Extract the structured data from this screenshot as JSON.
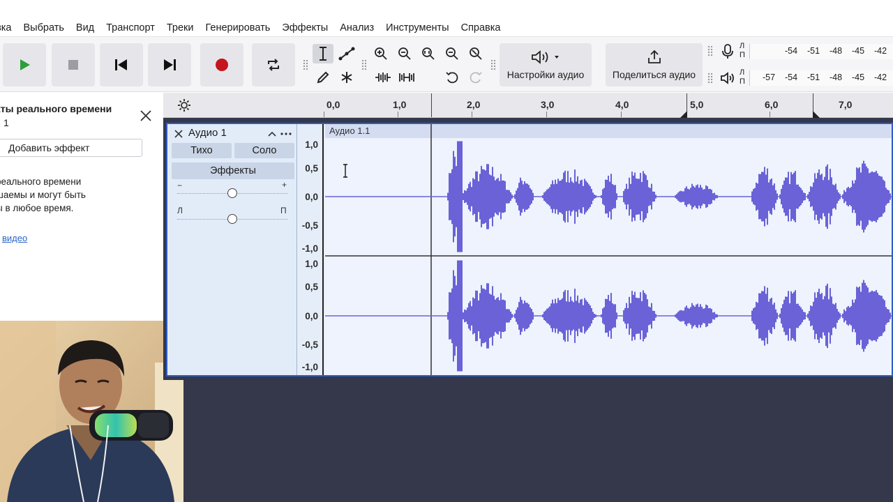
{
  "menu": {
    "items": [
      "авка",
      "Выбрать",
      "Вид",
      "Транспорт",
      "Треки",
      "Генерировать",
      "Эффекты",
      "Анализ",
      "Инструменты",
      "Справка"
    ]
  },
  "toolbar": {
    "audio_settings_label": "Настройки аудио",
    "share_label": "Поделиться аудио"
  },
  "meters": {
    "record": {
      "channel_labels": "Л\nП",
      "scale": [
        "-54",
        "-51",
        "-48",
        "-45",
        "-42"
      ]
    },
    "playback": {
      "channel_labels": "Л\nП",
      "scale": [
        "-57",
        "-54",
        "-51",
        "-48",
        "-45",
        "-42"
      ]
    }
  },
  "effects_panel": {
    "title": "екты реального времени",
    "subtitle": "1",
    "add_effect_label": "Добавить эффект",
    "info_lines": [
      "реального времени",
      "шаемы и могут быть",
      "ы в любое время."
    ],
    "link_text": "видео"
  },
  "timeline": {
    "labels": [
      "0,0",
      "1,0",
      "2,0",
      "3,0",
      "4,0",
      "5,0",
      "6,0",
      "7,0"
    ]
  },
  "track": {
    "name": "Аудио 1",
    "mute_label": "Тихо",
    "solo_label": "Соло",
    "effects_label": "Эффекты",
    "gain_minus": "−",
    "gain_plus": "+",
    "pan_left": "Л",
    "pan_right": "П",
    "gain_level": 0.5,
    "pan_level": 0.5,
    "clip_name": "Аудио 1.1",
    "scale_ch1": [
      "1,0",
      "0,5",
      "0,0",
      "-0,5",
      "-1,0"
    ],
    "scale_ch2": [
      "1,0",
      "0,5",
      "0,0",
      "-0,5",
      "-1,0"
    ]
  },
  "colors": {
    "waveform": "#6a62d6",
    "record": "#c4161c",
    "play": "#2e9e3c",
    "track_border": "#2f5cc8",
    "background_dark": "#34384a"
  }
}
